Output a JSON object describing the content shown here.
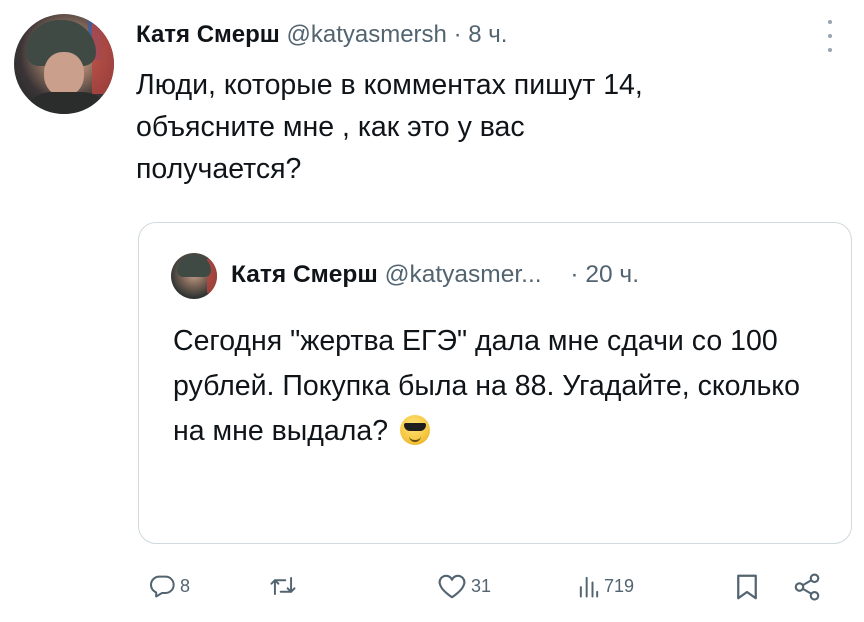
{
  "tweet": {
    "author_name": "Катя Смерш",
    "handle": "@katyasmersh",
    "separator": "·",
    "time": "8 ч.",
    "text": "Люди, которые в комментах пишут 14,\nобъясните мне , как это у вас\nполучается?"
  },
  "quoted_tweet": {
    "author_name": "Катя Смерш",
    "handle": "@katyasmer...",
    "separator": "·",
    "time": "20 ч.",
    "text": "Сегодня \"жертва ЕГЭ\" дала мне сдачи со 100 рублей. Покупка была на 88. Угадайте, сколько на мне выдала?",
    "emoji": "smiling-face-with-sunglasses"
  },
  "actions": {
    "reply_count": "8",
    "retweet_count": "",
    "like_count": "31",
    "views_count": "719"
  },
  "icons": [
    "more-vertical-icon",
    "reply-icon",
    "retweet-icon",
    "like-icon",
    "views-icon",
    "bookmark-icon",
    "share-icon"
  ],
  "colors": {
    "text_primary": "#0f1419",
    "text_secondary": "#536471",
    "border": "#cfd9de"
  }
}
